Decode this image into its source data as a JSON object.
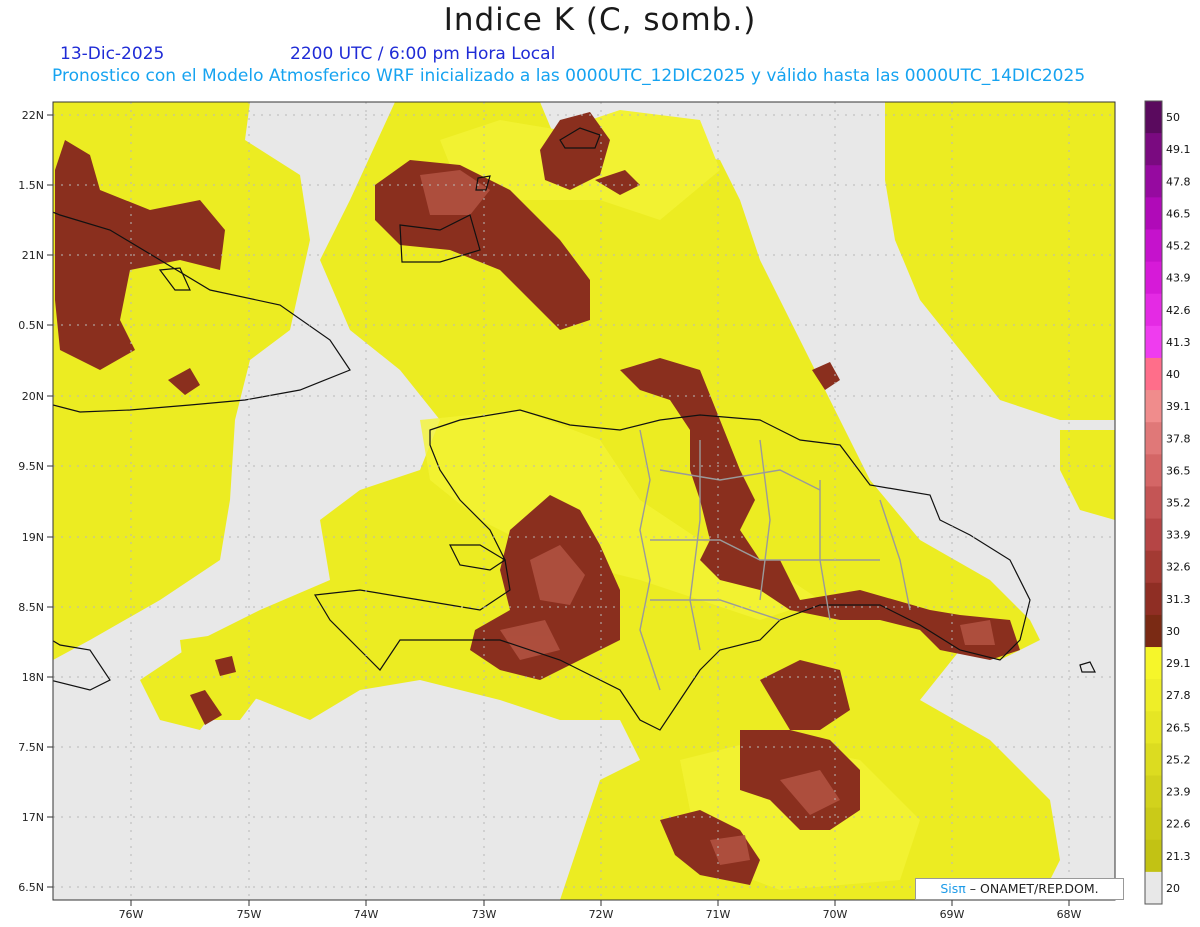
{
  "header": {
    "title": "Indice K (C, somb.)",
    "date": "13-Dic-2025",
    "time_label": "2200 UTC / 6:00 pm Hora Local",
    "description": "Pronostico con el Modelo Atmosferico WRF inicializado a las 0000UTC_12DIC2025 y válido hasta las  0000UTC_14DIC2025"
  },
  "map": {
    "lat_labels": [
      "22N",
      "1.5N",
      "21N",
      "0.5N",
      "20N",
      "9.5N",
      "19N",
      "8.5N",
      "18N",
      "7.5N",
      "17N",
      "6.5N"
    ],
    "lon_labels": [
      "76W",
      "75W",
      "74W",
      "73W",
      "72W",
      "71W",
      "70W",
      "69W",
      "68W"
    ],
    "background_color": "#e8e8e8",
    "fill_colors": {
      "low": "#e3e31a",
      "mid": "#f0f02e",
      "high": "#8a2f1e",
      "peak": "#b35443"
    }
  },
  "colorbar": {
    "levels": [
      "50",
      "49.1",
      "47.8",
      "46.5",
      "45.2",
      "43.9",
      "42.6",
      "41.3",
      "40",
      "39.1",
      "37.8",
      "36.5",
      "35.2",
      "33.9",
      "32.6",
      "31.3",
      "30",
      "29.1",
      "27.8",
      "26.5",
      "25.2",
      "23.9",
      "22.6",
      "21.3",
      "20"
    ],
    "colors": [
      "#5a0a5e",
      "#7a0a80",
      "#960aa0",
      "#b00ab8",
      "#c512cc",
      "#d61ad8",
      "#e42ae4",
      "#ef3cef",
      "#ff6e8a",
      "#f08c8c",
      "#e07878",
      "#d46666",
      "#c45555",
      "#b54545",
      "#a33a33",
      "#8f2e24",
      "#7a2a14",
      "#f6f62a",
      "#eeee28",
      "#e6e624",
      "#dcdc20",
      "#d2d21c",
      "#caca18",
      "#c2c214",
      "#e8e8e8"
    ]
  },
  "credit": {
    "sis": "Sisπ",
    "rest": " – ONAMET/REP.DOM."
  }
}
